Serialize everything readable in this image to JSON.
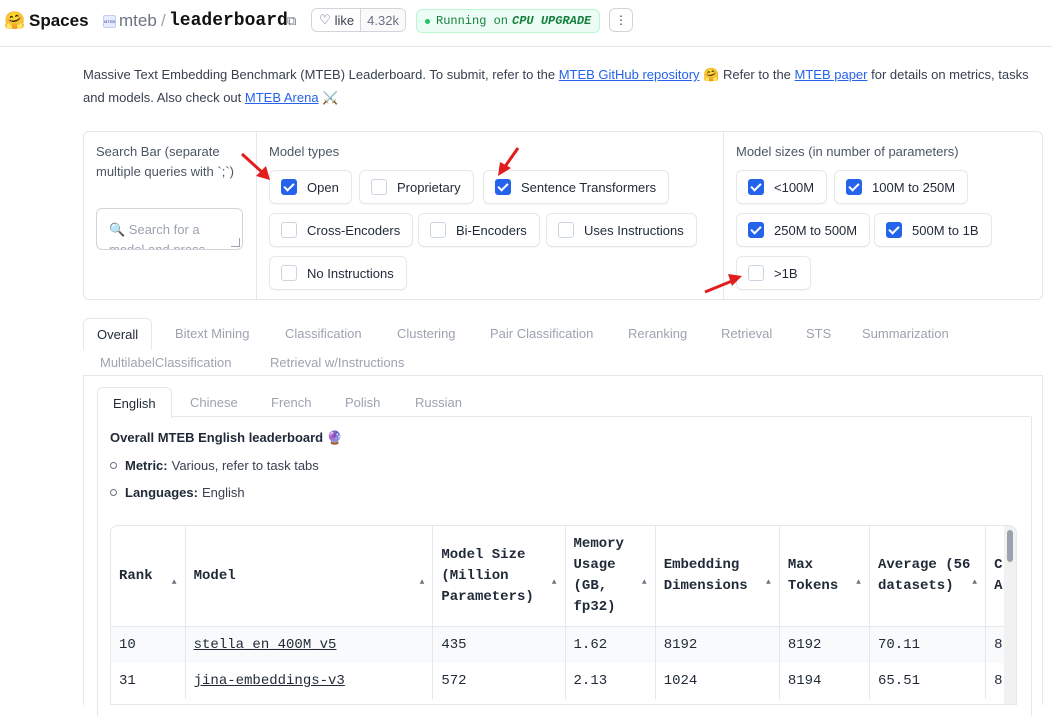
{
  "header": {
    "logo": "🤗",
    "spaces": "Spaces",
    "org_avatar": "MTEB",
    "org": "mteb",
    "separator": "/",
    "repo": "leaderboard",
    "copy_icon": "⧉",
    "like_icon": "♡",
    "like_label": "like",
    "like_count": "4.32k",
    "status_prefix": "Running on",
    "status_hw": "CPU UPGRADE",
    "menu_icon": "⋮"
  },
  "intro": {
    "t1": "Massive Text Embedding Benchmark (MTEB) Leaderboard. To submit, refer to the ",
    "link1": "MTEB GitHub repository",
    "t2": " 🤗 Refer to the ",
    "link2": "MTEB paper",
    "t3": " for details on metrics, tasks and models. Also check out ",
    "link3": "MTEB Arena",
    "t4": " ⚔️"
  },
  "filters": {
    "search_label": "Search Bar (separate multiple queries with `;`)",
    "search_placeholder": "🔍 Search for a model and press enter",
    "model_types_label": "Model types",
    "model_types": [
      {
        "label": "Open",
        "checked": true
      },
      {
        "label": "Proprietary",
        "checked": false
      },
      {
        "label": "Sentence Transformers",
        "checked": true
      },
      {
        "label": "Cross-Encoders",
        "checked": false
      },
      {
        "label": "Bi-Encoders",
        "checked": false
      },
      {
        "label": "Uses Instructions",
        "checked": false
      },
      {
        "label": "No Instructions",
        "checked": false
      }
    ],
    "model_sizes_label": "Model sizes (in number of parameters)",
    "model_sizes": [
      {
        "label": "<100M",
        "checked": true
      },
      {
        "label": "100M to 250M",
        "checked": true
      },
      {
        "label": "250M to 500M",
        "checked": true
      },
      {
        "label": "500M to 1B",
        "checked": true
      },
      {
        "label": ">1B",
        "checked": false
      }
    ]
  },
  "task_tabs": [
    "Overall",
    "Bitext Mining",
    "Classification",
    "Clustering",
    "Pair Classification",
    "Reranking",
    "Retrieval",
    "STS",
    "Summarization",
    "MultilabelClassification",
    "Retrieval w/Instructions"
  ],
  "lang_tabs": [
    "English",
    "Chinese",
    "French",
    "Polish",
    "Russian"
  ],
  "panel": {
    "title": "Overall MTEB English leaderboard 🔮",
    "metric_key": "Metric:",
    "metric_val": "Various, refer to task tabs",
    "lang_key": "Languages:",
    "lang_val": "English"
  },
  "table": {
    "headers": [
      "Rank",
      "Model",
      "Model Size (Million Parameters)",
      "Memory Usage (GB, fp32)",
      "Embedding Dimensions",
      "Max Tokens",
      "Average (56 datasets)",
      "C A"
    ],
    "rows": [
      [
        "10",
        "stella_en_400M_v5",
        "435",
        "1.62",
        "8192",
        "8192",
        "70.11",
        "8"
      ],
      [
        "31",
        "jina-embeddings-v3",
        "572",
        "2.13",
        "1024",
        "8194",
        "65.51",
        "8"
      ]
    ]
  },
  "colors": {
    "accent": "#2563eb",
    "status_green": "#15803d",
    "arrow_red": "#e11d1d"
  }
}
